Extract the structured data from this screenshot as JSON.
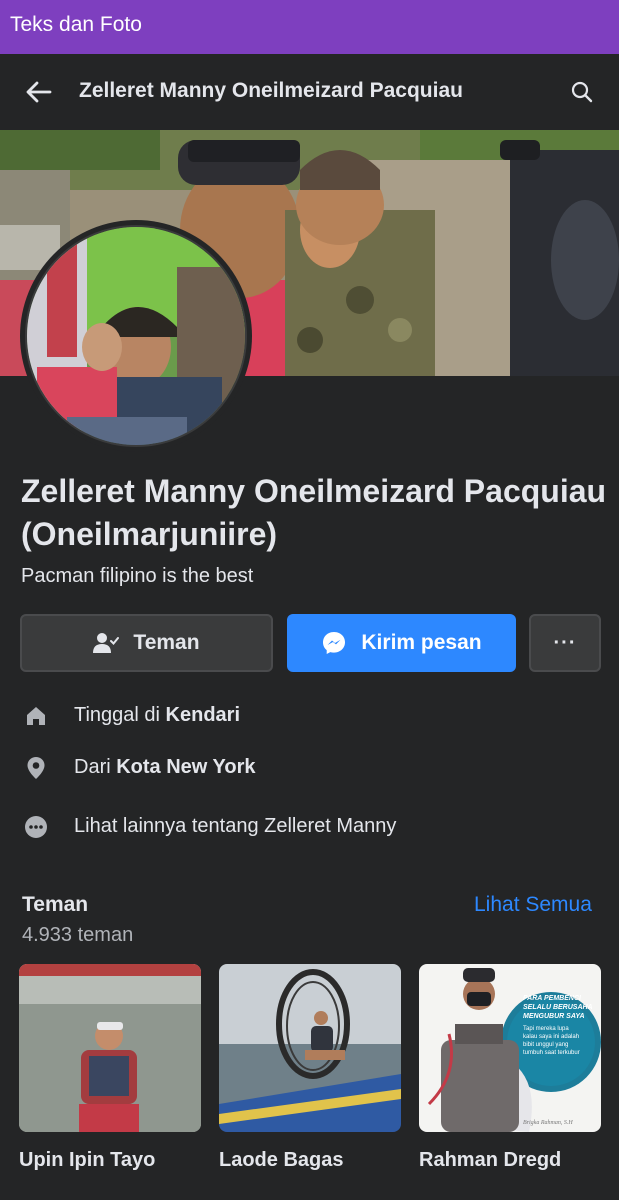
{
  "status_bar": {
    "title": "Teks dan Foto"
  },
  "navbar": {
    "title": "Zelleret Manny Oneilmeizard Pacquiau",
    "back_icon": "arrow-left-icon",
    "search_icon": "search-icon"
  },
  "profile": {
    "name": "Zelleret Manny Oneilmeizard Pacquiau (Oneilmarjuniire)",
    "bio": "Pacman filipino is the best"
  },
  "actions": {
    "friend_label": "Teman",
    "message_label": "Kirim pesan",
    "more_label": "···"
  },
  "info": {
    "lives_prefix": "Tinggal di",
    "lives_value": "Kendari",
    "from_prefix": "Dari",
    "from_value": "Kota New York",
    "more_text": "Lihat lainnya tentang Zelleret Manny"
  },
  "friends": {
    "title": "Teman",
    "count": "4.933 teman",
    "see_all": "Lihat Semua",
    "items": [
      {
        "name": "Upin Ipin Tayo"
      },
      {
        "name": "Laode Bagas"
      },
      {
        "name": "Rahman Dregd"
      }
    ]
  },
  "poster": {
    "line1": "PARA PEMBENCI",
    "line2": "SELALU BERUSAHA",
    "line3": "MENGUBUR SAYA",
    "line4": "Tapi mereka lupa",
    "line5": "kalau saya ini adalah",
    "line6": "bibit unggul yang",
    "line7": "tumbuh saat terkubur",
    "signature": "Brigka Rahman, S.H"
  },
  "colors": {
    "accent_purple": "#7e3fbf",
    "primary_blue": "#2d88ff",
    "background": "#242526",
    "button_gray": "#3a3b3c"
  }
}
